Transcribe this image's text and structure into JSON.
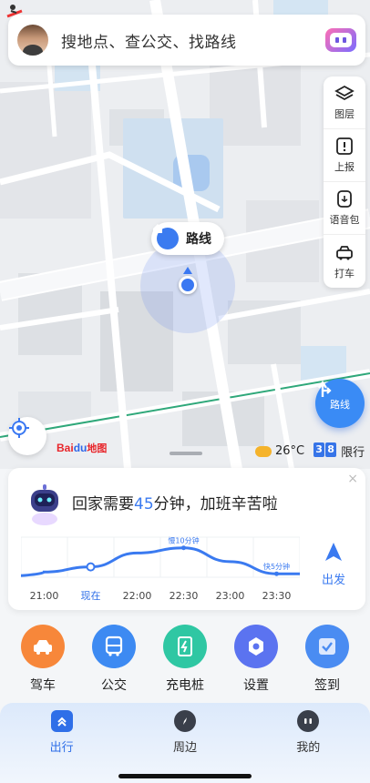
{
  "search": {
    "placeholder": "搜地点、查公交、找路线"
  },
  "toolbar": {
    "items": [
      {
        "label": "图层"
      },
      {
        "label": "上报"
      },
      {
        "label": "语音包"
      },
      {
        "label": "打车"
      }
    ]
  },
  "map": {
    "route_pin_label": "路线",
    "route_button_label": "路线",
    "logo_prefix": "Bai",
    "logo_du": "du",
    "logo_map": "地图",
    "temperature": "26°C",
    "plate_digits": [
      "3",
      "8"
    ],
    "restriction": "限行"
  },
  "card": {
    "msg_before": "回家需要",
    "msg_minutes": "45",
    "msg_after": "分钟，加班辛苦啦",
    "go_label": "出发",
    "close": "×"
  },
  "chart_data": {
    "type": "line",
    "x": [
      "21:00",
      "现在",
      "22:00",
      "22:30",
      "23:00",
      "23:30"
    ],
    "highlight_x": "现在",
    "series": [
      {
        "values": [
          0.15,
          0.3,
          0.7,
          0.85,
          0.45,
          0.1
        ]
      }
    ],
    "annotations": [
      {
        "x": "22:30",
        "text": "慢10分钟"
      },
      {
        "x": "23:30",
        "text": "快5分钟"
      }
    ],
    "colors": {
      "line": "#3a7af0",
      "accent": "#2f6fe8"
    },
    "grid": true
  },
  "services": [
    {
      "label": "驾车",
      "color": "#f7873a",
      "icon": "car-icon"
    },
    {
      "label": "公交",
      "color": "#3d8af2",
      "icon": "bus-icon"
    },
    {
      "label": "充电桩",
      "color": "#2fc7a3",
      "icon": "charger-icon"
    },
    {
      "label": "设置",
      "color": "#5b73f0",
      "icon": "settings-icon"
    },
    {
      "label": "签到",
      "color": "#4a8cf2",
      "icon": "checkin-icon"
    }
  ],
  "nav": [
    {
      "label": "出行",
      "active": true
    },
    {
      "label": "周边",
      "active": false
    },
    {
      "label": "我的",
      "active": false
    }
  ]
}
